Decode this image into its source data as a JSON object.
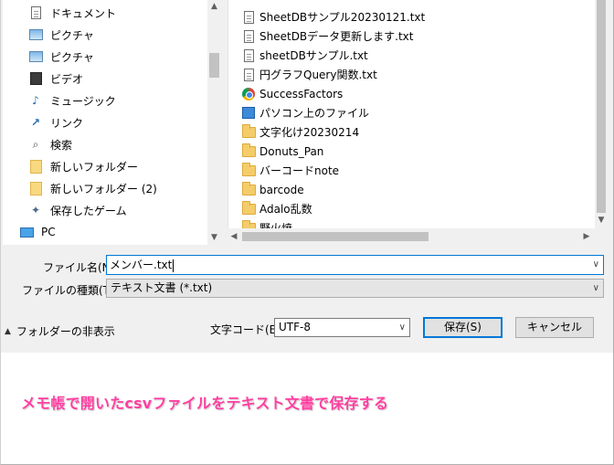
{
  "nav": {
    "items": [
      {
        "label": "ドキュメント",
        "icon": "document-folder-icon"
      },
      {
        "label": "ピクチャ",
        "icon": "pictures-icon"
      },
      {
        "label": "ピクチャ",
        "icon": "pictures-icon"
      },
      {
        "label": "ビデオ",
        "icon": "video-icon"
      },
      {
        "label": "ミュージック",
        "icon": "music-icon"
      },
      {
        "label": "リンク",
        "icon": "link-arrow-icon"
      },
      {
        "label": "検索",
        "icon": "search-icon"
      },
      {
        "label": "新しいフォルダー",
        "icon": "folder-icon"
      },
      {
        "label": "新しいフォルダー (2)",
        "icon": "folder-icon"
      },
      {
        "label": "保存したゲーム",
        "icon": "game-icon"
      },
      {
        "label": "PC",
        "icon": "pc-icon"
      }
    ]
  },
  "files": {
    "items": [
      {
        "label": "SheetDBサンプル20230121.txt",
        "icon": "text-file-icon"
      },
      {
        "label": "SheetDBデータ更新します.txt",
        "icon": "text-file-icon"
      },
      {
        "label": "sheetDBサンプル.txt",
        "icon": "text-file-icon"
      },
      {
        "label": "円グラフQuery関数.txt",
        "icon": "text-file-icon"
      },
      {
        "label": "SuccessFactors",
        "icon": "chrome-icon"
      },
      {
        "label": "パソコン上のファイル",
        "icon": "shortcut-icon"
      },
      {
        "label": "文字化け20230214",
        "icon": "folder-icon"
      },
      {
        "label": "Donuts_Pan",
        "icon": "folder-icon"
      },
      {
        "label": "バーコードnote",
        "icon": "folder-icon"
      },
      {
        "label": "barcode",
        "icon": "folder-icon"
      },
      {
        "label": "Adalo乱数",
        "icon": "folder-icon"
      },
      {
        "label": "野火焼",
        "icon": "folder-icon"
      }
    ]
  },
  "form": {
    "filename_label": "ファイル名(N):",
    "filename_value": "メンバー.txt",
    "filetype_label": "ファイルの種類(T):",
    "filetype_value": "テキスト文書 (*.txt)",
    "encoding_label": "文字コード(E):",
    "encoding_value": "UTF-8",
    "save_label": "保存(S)",
    "cancel_label": "キャンセル",
    "hide_folders_label": "フォルダーの非表示"
  },
  "caption": "メモ帳で開いたcsvファイルをテキスト文書で保存する",
  "colors": {
    "accent": "#0078d7",
    "caption": "#ff3ea0",
    "folder": "#f4cd6a"
  }
}
